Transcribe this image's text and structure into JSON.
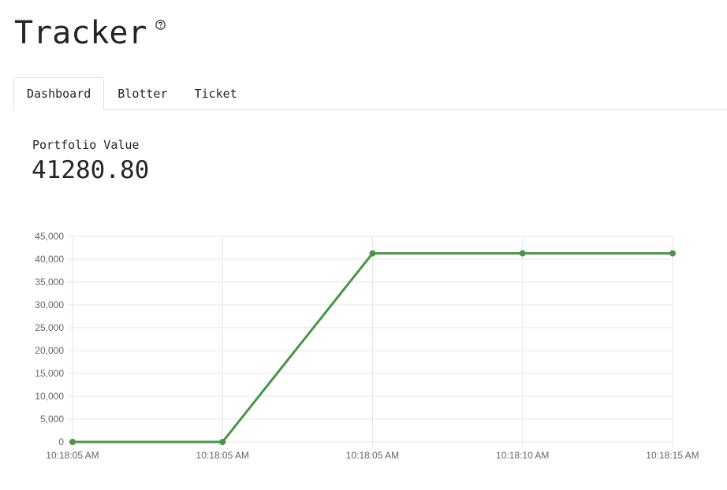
{
  "app": {
    "title": "Tracker",
    "help_icon": "question-circle-icon"
  },
  "tabs": [
    {
      "label": "Dashboard",
      "active": true
    },
    {
      "label": "Blotter",
      "active": false
    },
    {
      "label": "Ticket",
      "active": false
    }
  ],
  "dashboard": {
    "metric_label": "Portfolio Value",
    "metric_value": "41280.80"
  },
  "colors": {
    "line": "#4a9447",
    "grid": "#e5e5e5",
    "tick_text": "#666666"
  },
  "chart_data": {
    "type": "line",
    "x": [
      "10:18:05 AM",
      "10:18:05 AM",
      "10:18:05 AM",
      "10:18:10 AM",
      "10:18:15 AM"
    ],
    "series": [
      {
        "values": [
          0,
          0,
          41280.8,
          41280.8,
          41280.8
        ]
      }
    ],
    "ylim": [
      0,
      45000
    ],
    "yticks": [
      "0",
      "5,000",
      "10,000",
      "15,000",
      "20,000",
      "25,000",
      "30,000",
      "35,000",
      "40,000",
      "45,000"
    ],
    "grid": true,
    "legend": "none"
  }
}
